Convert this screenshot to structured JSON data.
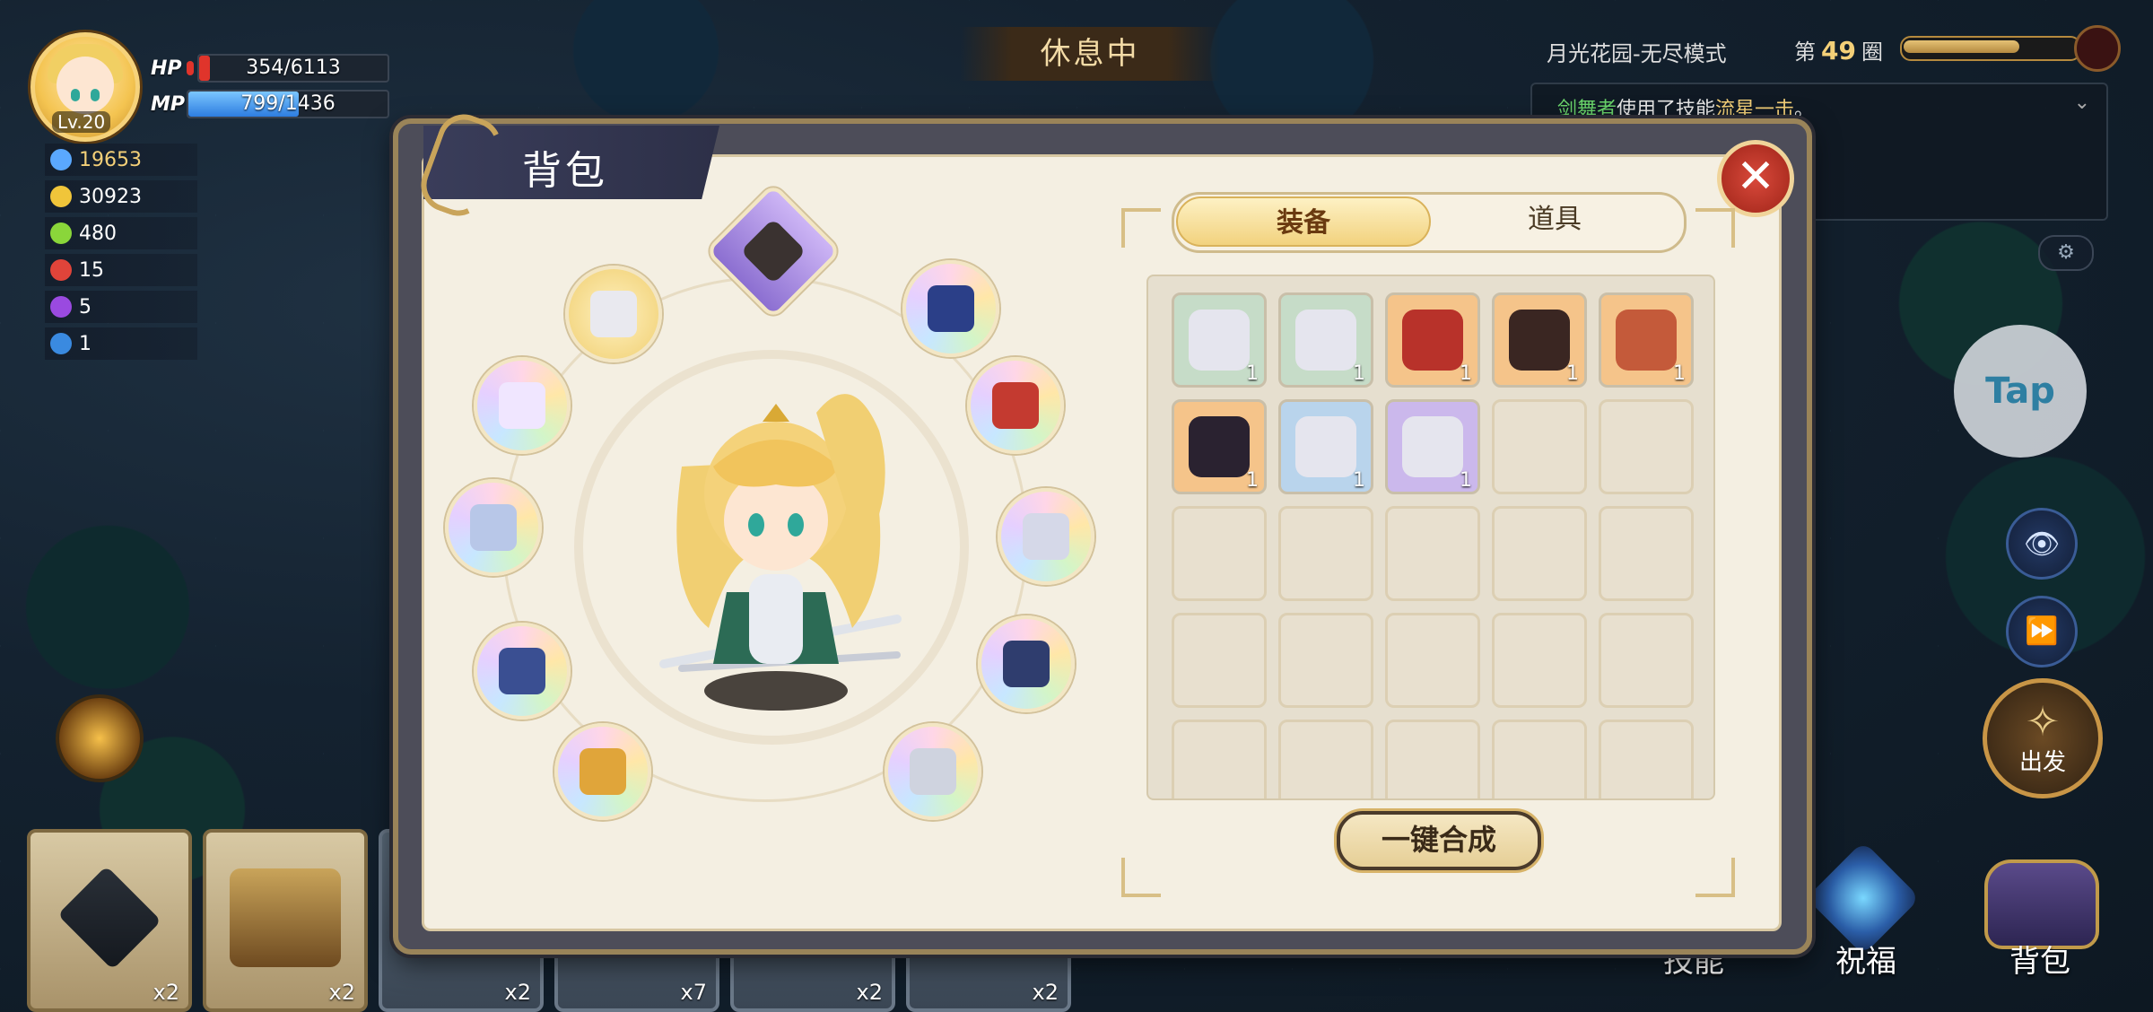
{
  "player": {
    "level": "Lv.20",
    "hp_label": "HP",
    "hp_text": "354/6113",
    "hp_fraction": 0.058,
    "mp_label": "MP",
    "mp_text": "799/1436",
    "mp_fraction": 0.556
  },
  "resources": [
    {
      "icon": "sword-icon",
      "value": "19653",
      "color": "#f4d078"
    },
    {
      "icon": "coin-icon",
      "value": "30923",
      "color": "#ffffff"
    },
    {
      "icon": "gem-icon",
      "value": "480",
      "color": "#ffffff"
    },
    {
      "icon": "demon-red-icon",
      "value": "15",
      "color": "#ffffff"
    },
    {
      "icon": "demon-purple-icon",
      "value": "5",
      "color": "#ffffff"
    },
    {
      "icon": "question-icon",
      "value": "1",
      "color": "#ffffff"
    }
  ],
  "status": "休息中",
  "mode": "月光花园-无尽模式",
  "wave": {
    "prefix": "第",
    "number": "49",
    "suffix": "圈",
    "progress": 0.65
  },
  "log": {
    "actor": "剑舞者",
    "mid": "使用了技能",
    "skill": "流星一击",
    "end": "。"
  },
  "right_controls": {
    "tap": "Tap",
    "depart": "出发"
  },
  "bottom_tabs": {
    "skills": "技能",
    "blessing": "祝福",
    "bag": "背包"
  },
  "cards": [
    {
      "count": "x2",
      "kind": "tile"
    },
    {
      "count": "x2",
      "kind": "chest"
    },
    {
      "count": "x2",
      "kind": "dim"
    },
    {
      "count": "x7",
      "kind": "dim"
    },
    {
      "count": "x2",
      "kind": "dim"
    },
    {
      "count": "x2",
      "kind": "dim"
    }
  ],
  "bag": {
    "title": "背包",
    "tabs": {
      "equipment": "装备",
      "items": "道具"
    },
    "synthesize": "一键合成",
    "slots": [
      {
        "name": "slot-top-amulet",
        "style": "purpletop",
        "gear": "#3a3230"
      },
      {
        "name": "slot-shoulder",
        "style": "gold",
        "gear": "#e9e9ef"
      },
      {
        "name": "slot-necklace",
        "style": "rainbow",
        "gear": "#2b3f88"
      },
      {
        "name": "slot-ring-left",
        "style": "rainbow",
        "gear": "#f0e6ff"
      },
      {
        "name": "slot-cloak",
        "style": "rainbow",
        "gear": "#c43a30"
      },
      {
        "name": "slot-armor",
        "style": "rainbow",
        "gear": "#b8c7e8"
      },
      {
        "name": "slot-boots",
        "style": "rainbow",
        "gear": "#d5d8e8"
      },
      {
        "name": "slot-bracelet",
        "style": "rainbow",
        "gear": "#3a4f92"
      },
      {
        "name": "slot-belt",
        "style": "rainbow",
        "gear": "#2f3d6e"
      },
      {
        "name": "slot-sword",
        "style": "rainbow",
        "gear": "#e0a53a"
      },
      {
        "name": "slot-gauntlet",
        "style": "rainbow",
        "gear": "#cfd3df"
      }
    ],
    "items": [
      {
        "count": "1",
        "bg": "#c6dcc8",
        "art": "#e5e5ee"
      },
      {
        "count": "1",
        "bg": "#c6dcc8",
        "art": "#e5e5ee"
      },
      {
        "count": "1",
        "bg": "#f5c48a",
        "art": "#b8322a"
      },
      {
        "count": "1",
        "bg": "#f5c48a",
        "art": "#3a2622"
      },
      {
        "count": "1",
        "bg": "#f5c48a",
        "art": "#c45a3a"
      },
      {
        "count": "1",
        "bg": "#f5c48a",
        "art": "#2a2230"
      },
      {
        "count": "1",
        "bg": "#b9d4ec",
        "art": "#e5e5ee"
      },
      {
        "count": "1",
        "bg": "#cbb8ec",
        "art": "#e5e5ee"
      }
    ]
  }
}
